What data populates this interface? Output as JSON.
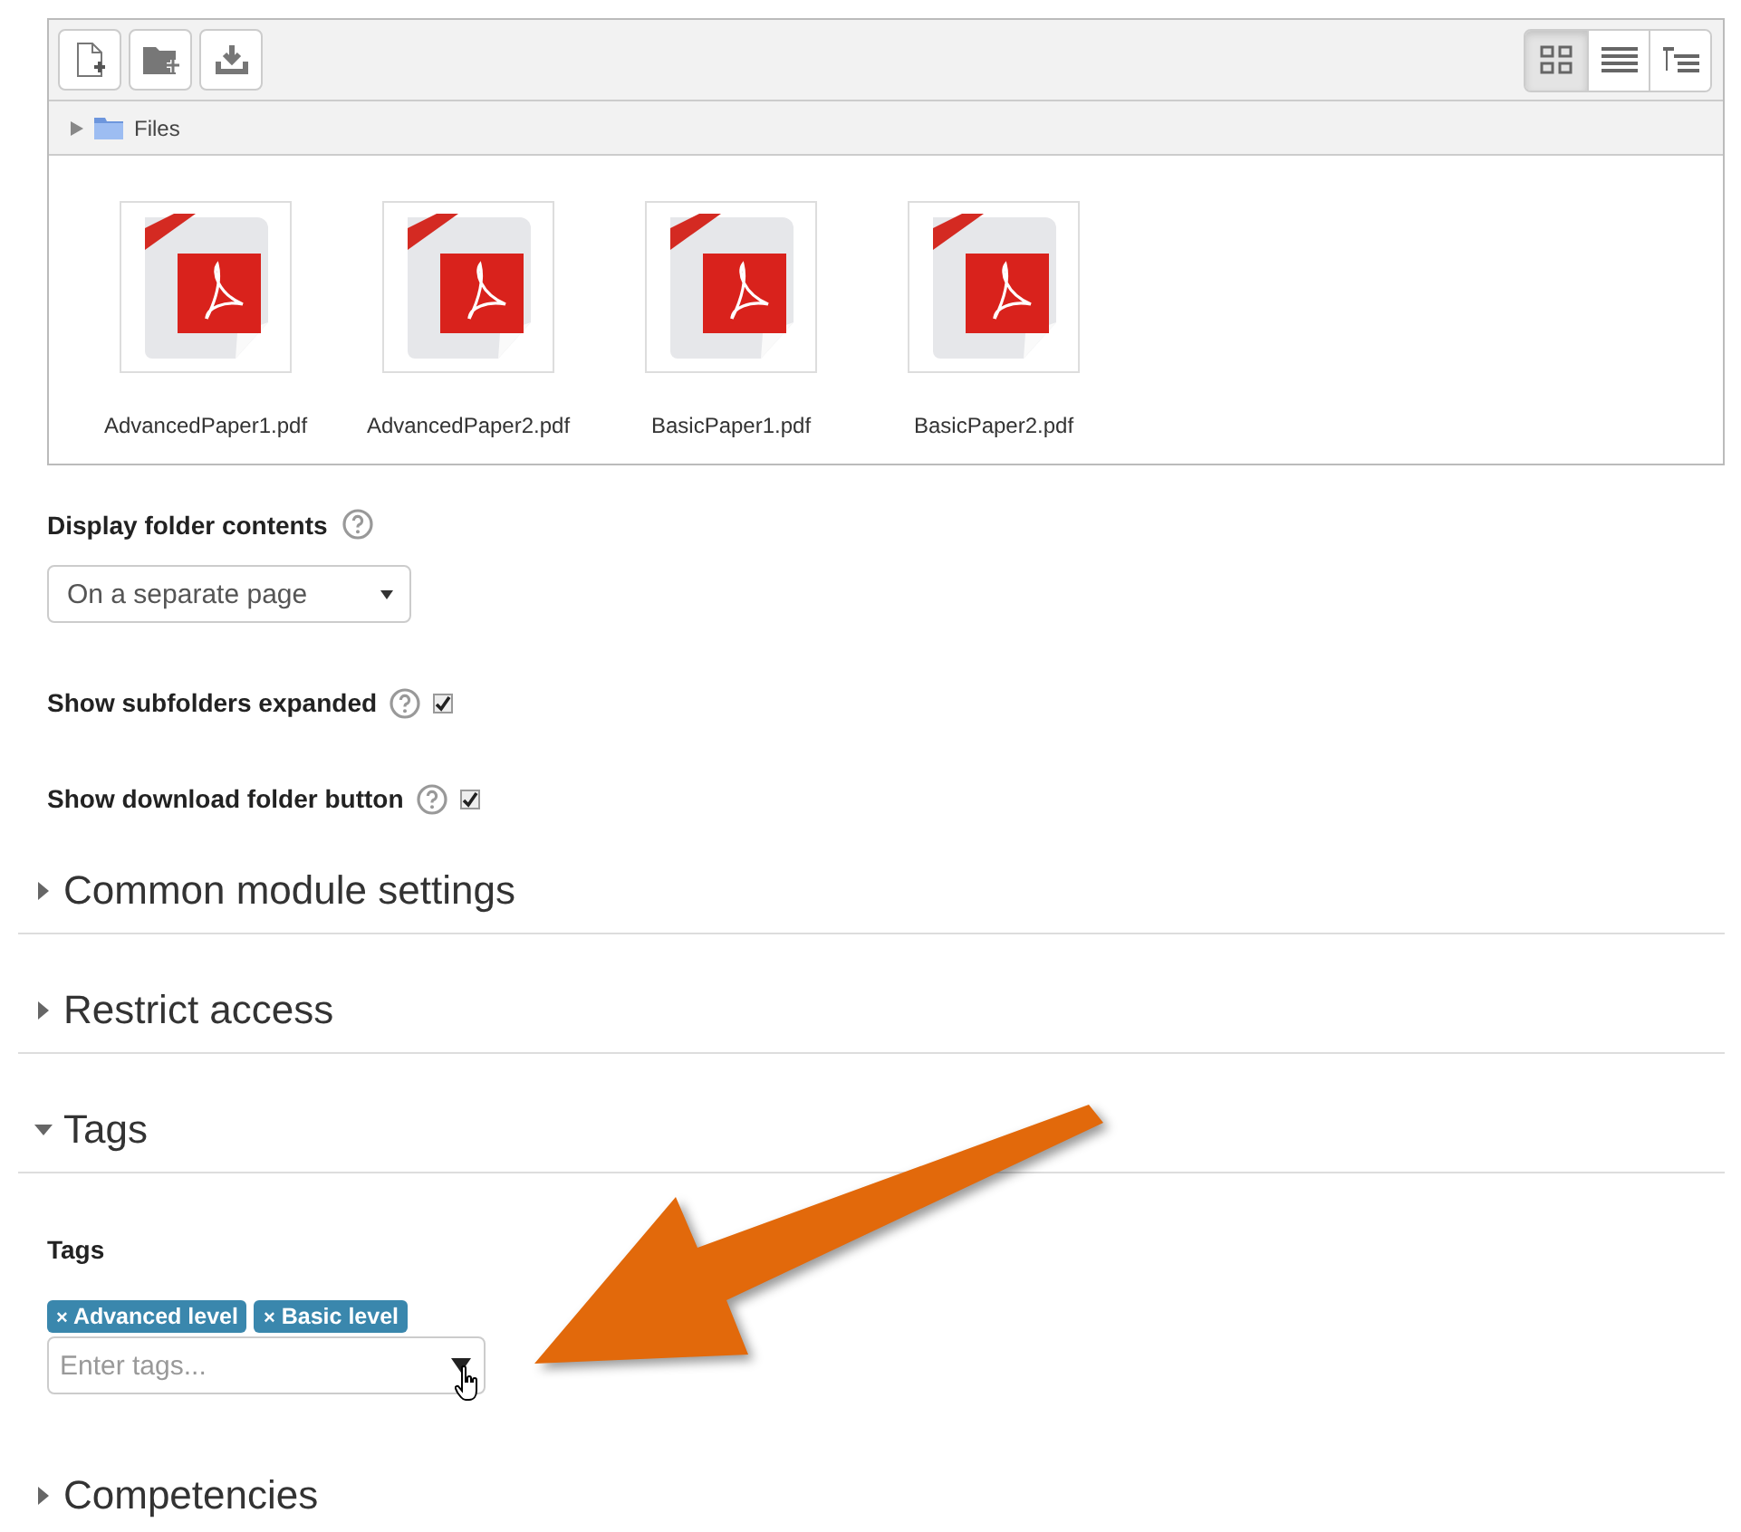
{
  "file_manager": {
    "view_modes": [
      {
        "kind": "icons",
        "selected": true
      },
      {
        "kind": "list",
        "selected": false
      },
      {
        "kind": "tree",
        "selected": false
      }
    ],
    "breadcrumb": {
      "label": "Files"
    },
    "files": [
      {
        "name": "AdvancedPaper1.pdf"
      },
      {
        "name": "AdvancedPaper2.pdf"
      },
      {
        "name": "BasicPaper1.pdf"
      },
      {
        "name": "BasicPaper2.pdf"
      }
    ]
  },
  "display_folder_contents": {
    "label": "Display folder contents",
    "value": "On a separate page"
  },
  "options": [
    {
      "label": "Show subfolders expanded",
      "checked": true
    },
    {
      "label": "Show download folder button",
      "checked": true
    }
  ],
  "sections": [
    {
      "title": "Common module settings",
      "expanded": false
    },
    {
      "title": "Restrict access",
      "expanded": false
    },
    {
      "title": "Tags",
      "expanded": true,
      "field_label": "Tags",
      "tags": [
        {
          "remove": "×",
          "label": "Advanced level"
        },
        {
          "remove": "×",
          "label": "Basic level"
        }
      ],
      "placeholder": "Enter tags..."
    },
    {
      "title": "Competencies",
      "expanded": false
    }
  ]
}
